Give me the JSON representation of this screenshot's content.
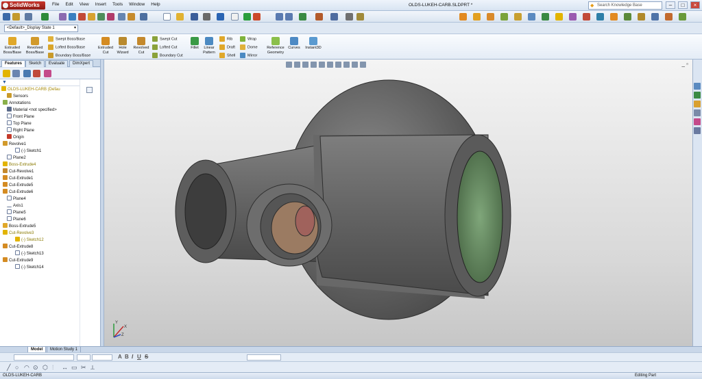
{
  "app": {
    "name": "SolidWorks",
    "document_title": "OLDS-LUKEH-CARB.SLDPRT *",
    "menu": [
      "File",
      "Edit",
      "View",
      "Insert",
      "Tools",
      "Window",
      "Help"
    ],
    "search_placeholder": "Search Knowledge Base",
    "window_controls": [
      "–",
      "□",
      "×"
    ]
  },
  "config": {
    "value": "<Default>_Display State 1"
  },
  "ribbon": {
    "large": [
      {
        "label": "Extruded Boss/Base",
        "icon": "extrude-icon"
      },
      {
        "label": "Revolved Boss/Base",
        "icon": "revolve-icon"
      },
      {
        "label": "Extruded Cut",
        "icon": "extruded-cut-icon"
      },
      {
        "label": "Hole Wizard",
        "icon": "hole-wizard-icon"
      },
      {
        "label": "Revolved Cut",
        "icon": "revolved-cut-icon"
      },
      {
        "label": "Fillet",
        "icon": "fillet-icon"
      },
      {
        "label": "Linear Pattern",
        "icon": "linear-pattern-icon"
      },
      {
        "label": "Reference Geometry",
        "icon": "reference-geometry-icon"
      },
      {
        "label": "Curves",
        "icon": "curves-icon"
      },
      {
        "label": "Instant3D",
        "icon": "instant3d-icon"
      }
    ],
    "small": [
      {
        "label": "Swept Boss/Base"
      },
      {
        "label": "Lofted Boss/Base"
      },
      {
        "label": "Boundary Boss/Base"
      },
      {
        "label": "Swept Cut"
      },
      {
        "label": "Lofted Cut"
      },
      {
        "label": "Boundary Cut"
      },
      {
        "label": "Rib"
      },
      {
        "label": "Draft"
      },
      {
        "label": "Shell"
      },
      {
        "label": "Wrap"
      },
      {
        "label": "Dome"
      },
      {
        "label": "Mirror"
      }
    ]
  },
  "cm_tabs": [
    "Features",
    "Sketch",
    "Evaluate",
    "DimXpert"
  ],
  "tree": {
    "root": "OLDS-LUKEH-CARB  (Defau",
    "items": [
      "Sensors",
      "Annotations",
      "Material <not specified>",
      "Front Plane",
      "Top Plane",
      "Right Plane",
      "Origin",
      "Revolve1",
      "(-) Sketch1",
      "Plane2",
      "Boss-Extrude4",
      "Cut-Revolve1",
      "Cut-Extrude1",
      "Cut-Extrude5",
      "Cut-Extrude6",
      "Plane4",
      "Axis1",
      "Plane5",
      "Plane6",
      "Boss-Extrude5",
      "Cut-Revolve3",
      "(-) Sketch12",
      "Cut-Extrude8",
      "(-) Sketch13",
      "Cut-Extrude9",
      "(-) Sketch14"
    ]
  },
  "model_tabs": [
    "Model",
    "Motion Study 1"
  ],
  "status": {
    "left": "OLDS-LUKEH-CARB",
    "right": "Editing Part"
  },
  "triad": {
    "x": "X",
    "y": "Y",
    "z": "Z"
  },
  "colors": {
    "part_body": "#6c6c6c",
    "bore_inner": "#6f9a6a",
    "warning": "#e2b400"
  }
}
